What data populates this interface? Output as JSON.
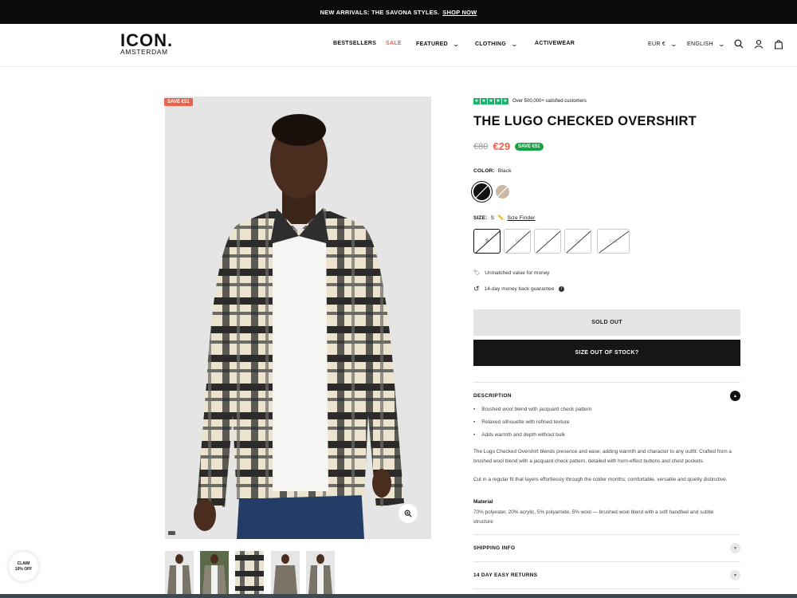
{
  "announcement": {
    "text": "NEW ARRIVALS: THE SAVONA STYLES.",
    "link": "SHOP NOW"
  },
  "header": {
    "logo_line1": "ICON.",
    "logo_line2": "AMSTERDAM",
    "nav": {
      "bestsellers": "BESTSELLERS",
      "sale": "SALE",
      "featured": "FEATURED",
      "clothing": "CLOTHING",
      "activewear": "ACTIVEWEAR"
    },
    "currency": "EUR €",
    "language": "ENGLISH"
  },
  "gallery": {
    "save_tag": "SAVE €51",
    "thumbnails": 5
  },
  "claim": {
    "line1": "CLAIM",
    "line2": "10% OFF"
  },
  "product": {
    "rating_text": "Over 500,000+ satisfied customers",
    "title": "THE LUGO CHECKED OVERSHIRT",
    "old_price": "€80",
    "price": "€29",
    "save_badge": "SAVE €51",
    "color_label": "COLOR:",
    "color_value": "Black",
    "colors": [
      "#111111",
      "#cbb7a5"
    ],
    "size_label": "SIZE:",
    "size_value": "S",
    "size_finder": "Size Finder",
    "sizes": [
      "S",
      "M",
      "L",
      "XL",
      "XXL"
    ],
    "features": [
      "Unmatched value for money",
      "14-day money back guarantee"
    ],
    "sold_out": "SOLD OUT",
    "size_out_of_stock": "SIZE OUT OF STOCK?"
  },
  "description": {
    "heading": "DESCRIPTION",
    "bullets": [
      "Brushed wool blend with jacquard check pattern",
      "Relaxed silhouette with refined texture",
      "Adds warmth and depth without bulk"
    ],
    "para1": "The Lugo Checked Overshirt blends presence and ease, adding warmth and character to any outfit. Crafted from a brushed wool blend with a jacquard check pattern, detailed with horn-effect buttons and chest pockets.",
    "para2": "Cut in a regular fit that layers effortlessly through the colder months; comfortable, versatile and quietly distinctive.",
    "material_title": "Material",
    "material": "70% polyester, 20% acrylic, 5% polyamide, 5% wool — brushed wool blend with a soft handfeel and subtle structure"
  },
  "accordion": {
    "shipping": "SHIPPING INFO",
    "returns": "14 DAY EASY RETURNS"
  },
  "colors": {
    "accent": "#e9644b",
    "save_green": "#1aa346",
    "star_green": "#1ab36a"
  }
}
